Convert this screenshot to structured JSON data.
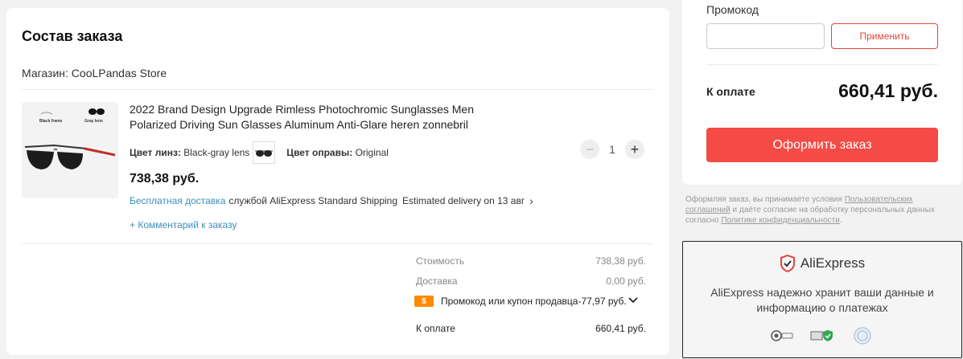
{
  "order": {
    "title": "Состав заказа",
    "store_prefix": "Магазин: ",
    "store_name": "CooLPandas Store",
    "product": {
      "image_label_left": "Black frame",
      "image_label_right": "Gray lens",
      "name": "2022 Brand Design Upgrade Rimless Photochromic Sunglasses Men Polarized Driving Sun Glasses Aluminum Anti-Glare heren zonnebril",
      "lens_color_label": "Цвет линз:",
      "lens_color_value": "Black-gray lens",
      "frame_color_label": "Цвет оправы:",
      "frame_color_value": "Original",
      "quantity": "1",
      "price": "738,38 руб.",
      "free_shipping": "Бесплатная доставка",
      "shipping_service": "службой AliExpress Standard Shipping",
      "delivery_estimate": "Estimated delivery on 13 авг",
      "comment_link": "+ Комментарий к заказу"
    },
    "summary": {
      "cost_label": "Стоимость",
      "cost_value": "738,38 руб.",
      "delivery_label": "Доставка",
      "delivery_value": "0,00 руб.",
      "coupon_icon": "$",
      "coupon_text": "Промокод или купон продавца-77,97 руб.",
      "total_label": "К оплате",
      "total_value": "660,41 руб."
    }
  },
  "payment": {
    "promo_label": "Промокод",
    "promo_placeholder": "",
    "apply_button": "Применить",
    "total_label": "К оплате",
    "total_value": "660,41 руб.",
    "checkout_button": "Оформить заказ",
    "accent_color": "#f44b46"
  },
  "terms": {
    "part1": "Оформляя заказ, вы принимаете условия ",
    "link1": "Пользовательских соглашений",
    "part2": " и даёте согласие на обработку персональных данных согласно ",
    "link2": "Политике конфиденциальности",
    "part3": "."
  },
  "trust": {
    "brand": "AliExpress",
    "text_line1": "AliExpress надежно хранит ваши данные и",
    "text_line2": "информацию о платежах"
  }
}
